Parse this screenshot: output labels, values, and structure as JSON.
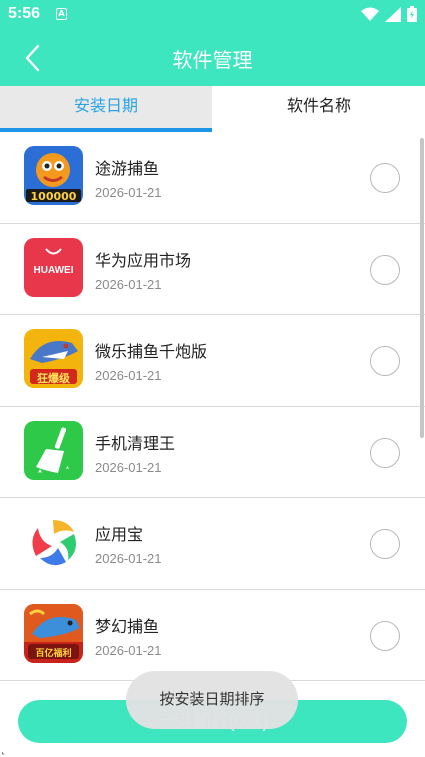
{
  "status_bar": {
    "time": "5:56",
    "notification_icon": "a-icon"
  },
  "header": {
    "title": "软件管理",
    "back_icon": "chevron-left-icon"
  },
  "tabs": [
    {
      "label": "安装日期",
      "active": true
    },
    {
      "label": "软件名称",
      "active": false
    }
  ],
  "apps": [
    {
      "name": "途游捕鱼",
      "date": "2026-01-21",
      "icon": "fish-game-icon"
    },
    {
      "name": "华为应用市场",
      "date": "2026-01-21",
      "icon": "huawei-appgallery-icon",
      "icon_text": "HUAWEI"
    },
    {
      "name": "微乐捕鱼千炮版",
      "date": "2026-01-21",
      "icon": "shark-game-icon",
      "icon_text": "狂爆级"
    },
    {
      "name": "手机清理王",
      "date": "2026-01-21",
      "icon": "broom-icon"
    },
    {
      "name": "应用宝",
      "date": "2026-01-21",
      "icon": "yingyongbao-icon"
    },
    {
      "name": "梦幻捕鱼",
      "date": "2026-01-21",
      "icon": "dream-fish-icon",
      "icon_text": "百亿福利"
    }
  ],
  "uninstall_button": "一键卸载(0款)",
  "toast": "按安装日期排序",
  "colors": {
    "accent": "#3ee6c0",
    "tab_active_text": "#2aa3e6",
    "tab_indicator": "#1e96e8"
  }
}
